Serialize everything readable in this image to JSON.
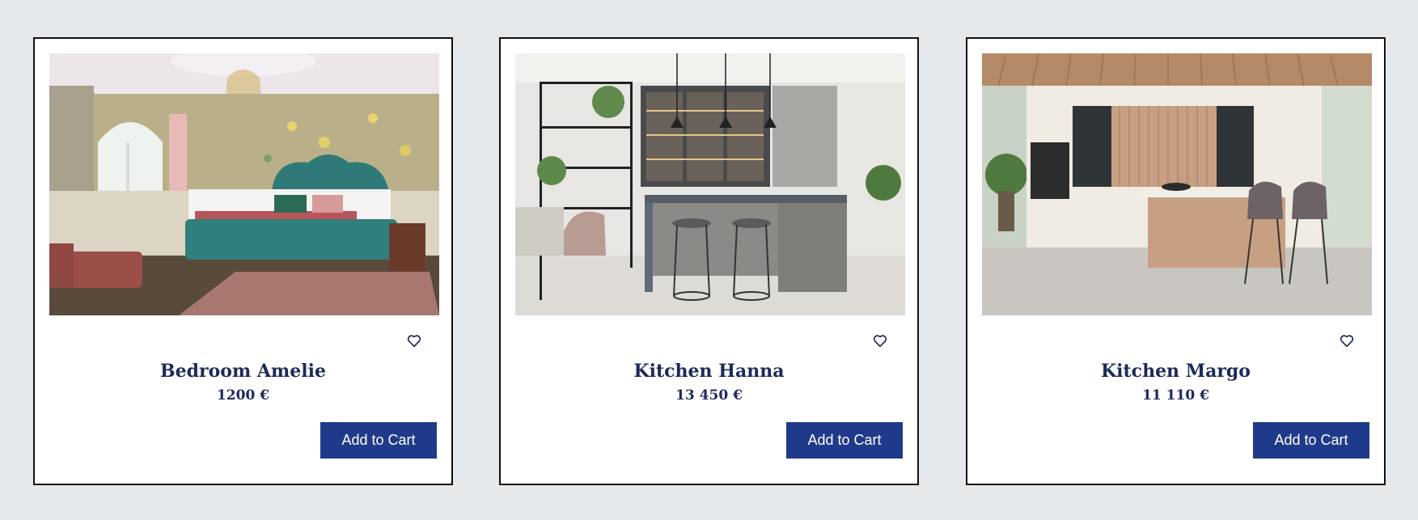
{
  "products": [
    {
      "title": "Bedroom Amelie",
      "price": "1200 €",
      "button_label": "Add to Cart",
      "image_icon": "bedroom-photo",
      "wishlist_icon": "heart-outline-icon"
    },
    {
      "title": "Kitchen Hanna",
      "price": "13 450 €",
      "button_label": "Add to Cart",
      "image_icon": "kitchen-photo",
      "wishlist_icon": "heart-outline-icon"
    },
    {
      "title": "Kitchen Margo",
      "price": "11 110 €",
      "button_label": "Add to Cart",
      "image_icon": "kitchen-photo",
      "wishlist_icon": "heart-outline-icon"
    }
  ],
  "colors": {
    "page_background": "#e6e9ec",
    "card_border": "#111111",
    "title_text": "#1c2a5a",
    "button_background": "#1f3a8a",
    "button_text": "#ffffff"
  }
}
